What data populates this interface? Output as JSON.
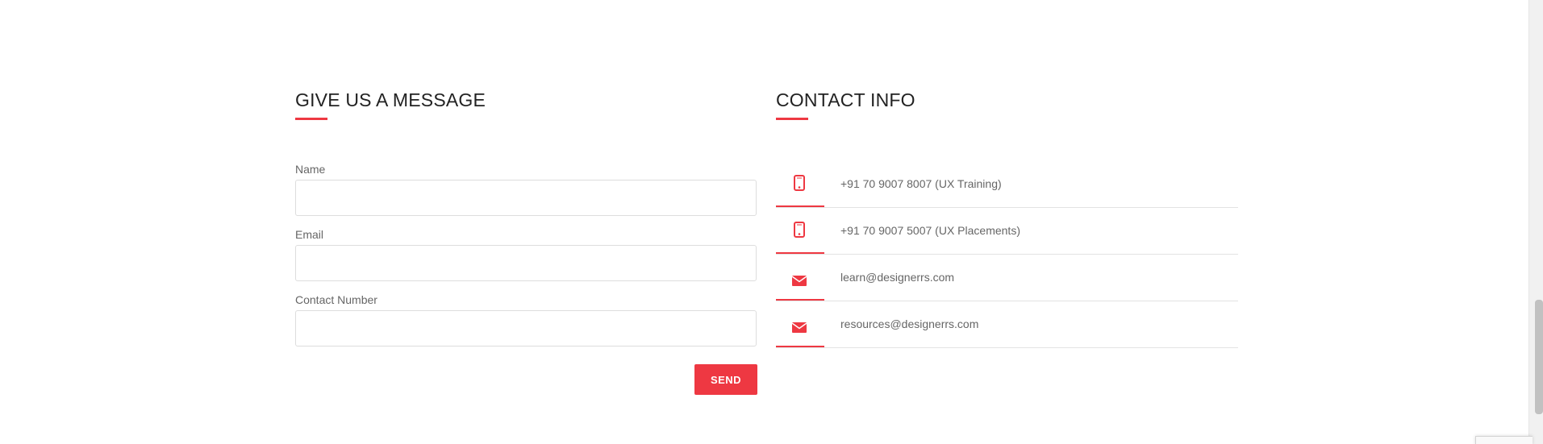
{
  "message_form": {
    "title": "GIVE US A MESSAGE",
    "fields": {
      "name": {
        "label": "Name",
        "value": "",
        "placeholder": ""
      },
      "email": {
        "label": "Email",
        "value": "",
        "placeholder": ""
      },
      "contact": {
        "label": "Contact Number",
        "value": "",
        "placeholder": ""
      }
    },
    "send_label": "SEND"
  },
  "contact_info": {
    "title": "CONTACT INFO",
    "items": [
      {
        "icon": "mobile-phone-icon",
        "text": "+91 70 9007 8007 (UX Training)"
      },
      {
        "icon": "mobile-phone-icon",
        "text": "+91 70 9007 5007 (UX Placements)"
      },
      {
        "icon": "envelope-icon",
        "text": "learn@designerrs.com"
      },
      {
        "icon": "envelope-icon",
        "text": "resources@designerrs.com"
      }
    ]
  },
  "theme": {
    "accent": "#ee3842",
    "heading_color": "#222222",
    "text_color": "#666666",
    "border_color": "#dddddd"
  }
}
